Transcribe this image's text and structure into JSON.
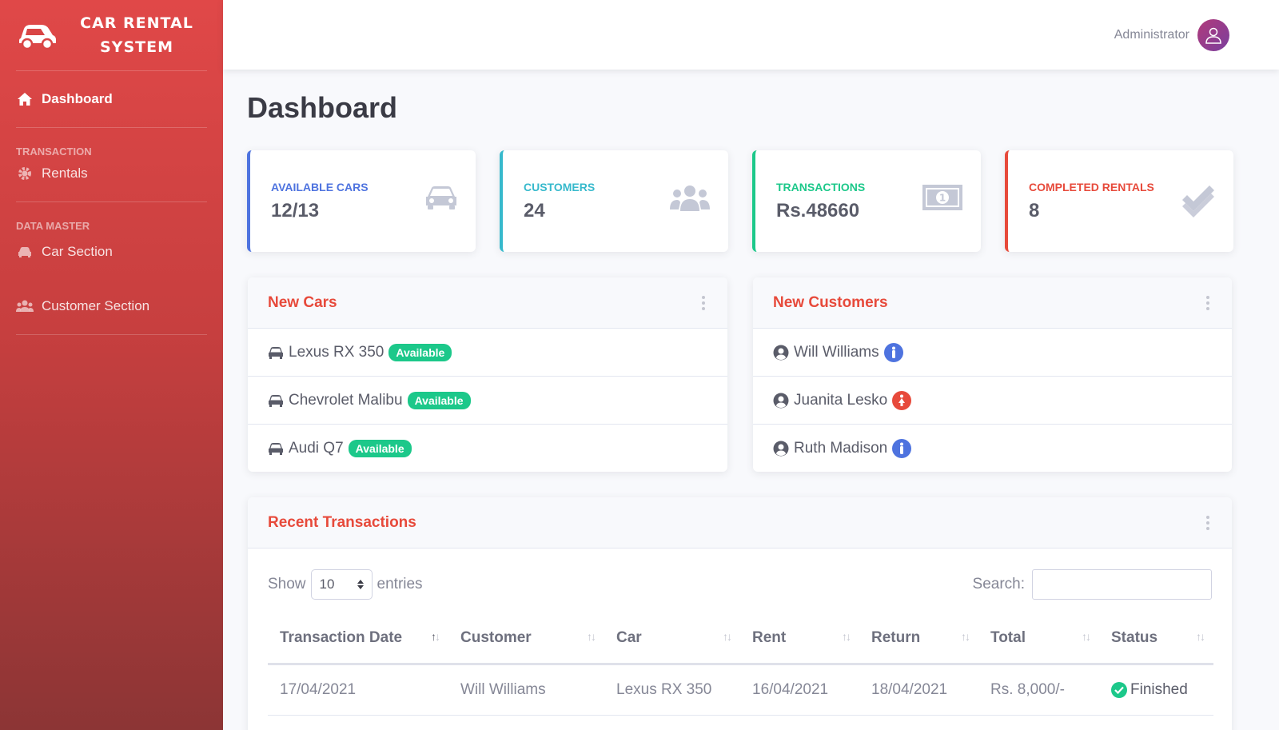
{
  "sidebar": {
    "brand": "CAR RENTAL SYSTEM",
    "items": [
      {
        "label": "Dashboard",
        "icon": "home-icon",
        "active": true
      },
      {
        "label": "Rentals",
        "icon": "gear-icon"
      },
      {
        "label": "Car Section",
        "icon": "car-icon"
      },
      {
        "label": "Customer Section",
        "icon": "users-icon"
      }
    ],
    "headings": [
      "TRANSACTION",
      "DATA MASTER"
    ]
  },
  "topbar": {
    "user_name": "Administrator"
  },
  "page": {
    "title": "Dashboard"
  },
  "stats": [
    {
      "label": "AVAILABLE CARS",
      "value": "12/13",
      "color": "#4e73df",
      "icon": "car-icon"
    },
    {
      "label": "CUSTOMERS",
      "value": "24",
      "color": "#36b9cc",
      "icon": "users-icon"
    },
    {
      "label": "TRANSACTIONS",
      "value": "Rs.48660",
      "color": "#1cc88a",
      "icon": "money-icon"
    },
    {
      "label": "COMPLETED RENTALS",
      "value": "8",
      "color": "#e74a3b",
      "icon": "double-check-icon"
    }
  ],
  "new_cars": {
    "title": "New Cars",
    "items": [
      {
        "name": "Lexus RX 350",
        "badge": "Available"
      },
      {
        "name": "Chevrolet Malibu",
        "badge": "Available"
      },
      {
        "name": "Audi Q7",
        "badge": "Available"
      }
    ]
  },
  "new_customers": {
    "title": "New Customers",
    "items": [
      {
        "name": "Will Williams",
        "gender": "male",
        "color": "#4e73df"
      },
      {
        "name": "Juanita Lesko",
        "gender": "female",
        "color": "#e74a3b"
      },
      {
        "name": "Ruth Madison",
        "gender": "male",
        "color": "#4e73df"
      }
    ]
  },
  "transactions": {
    "title": "Recent Transactions",
    "show_label": "Show",
    "entries_value": "10",
    "entries_label": "entries",
    "search_label": "Search:",
    "columns": [
      "Transaction Date",
      "Customer",
      "Car",
      "Rent",
      "Return",
      "Total",
      "Status"
    ],
    "rows": [
      {
        "date": "17/04/2021",
        "customer": "Will Williams",
        "car": "Lexus RX 350",
        "rent": "16/04/2021",
        "return": "18/04/2021",
        "total": "Rs. 8,000/-",
        "status": "Finished"
      }
    ]
  }
}
